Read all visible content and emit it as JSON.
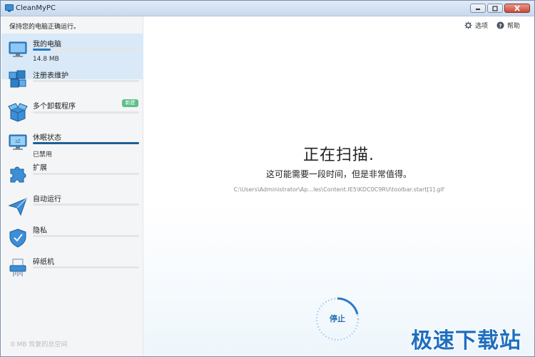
{
  "app": {
    "title": "CleanMyPC"
  },
  "sidebar": {
    "tagline": "保持您的电脑正确运行。",
    "items": [
      {
        "label": "我的电脑",
        "sub": "14.8 MB",
        "progress": 0.17,
        "icon": "monitor-icon"
      },
      {
        "label": "注册表维护",
        "progress": 0,
        "icon": "registry-blocks-icon"
      },
      {
        "label": "多个卸载程序",
        "badge": "新建",
        "progress": 0,
        "icon": "open-box-icon"
      },
      {
        "label": "休眠状态",
        "sub": "已禁用",
        "progress": 1.0,
        "icon": "hibernate-monitor-icon"
      },
      {
        "label": "扩展",
        "progress": 0,
        "icon": "puzzle-icon"
      },
      {
        "label": "自动运行",
        "progress": 0,
        "icon": "paper-plane-icon"
      },
      {
        "label": "隐私",
        "progress": 0,
        "icon": "shield-icon"
      },
      {
        "label": "碎纸机",
        "progress": 0,
        "icon": "shredder-icon"
      }
    ],
    "footer": "0 MB 恢复的总空间"
  },
  "toolbar": {
    "options_label": "选项",
    "help_label": "帮助"
  },
  "scan": {
    "headline": "正在扫描.",
    "subline": "这可能需要一段时间，但是非常值得。",
    "path": "C:\\Users\\Administrator\\Ap...les\\Content.IE5\\KDC0C9RU\\toolbar.start[1].gif",
    "stop_label": "停止"
  },
  "watermark": "极速下载站",
  "colors": {
    "accent": "#2a7ac0",
    "badge": "#5cc08a",
    "active_bg": "#d9e9f8"
  }
}
